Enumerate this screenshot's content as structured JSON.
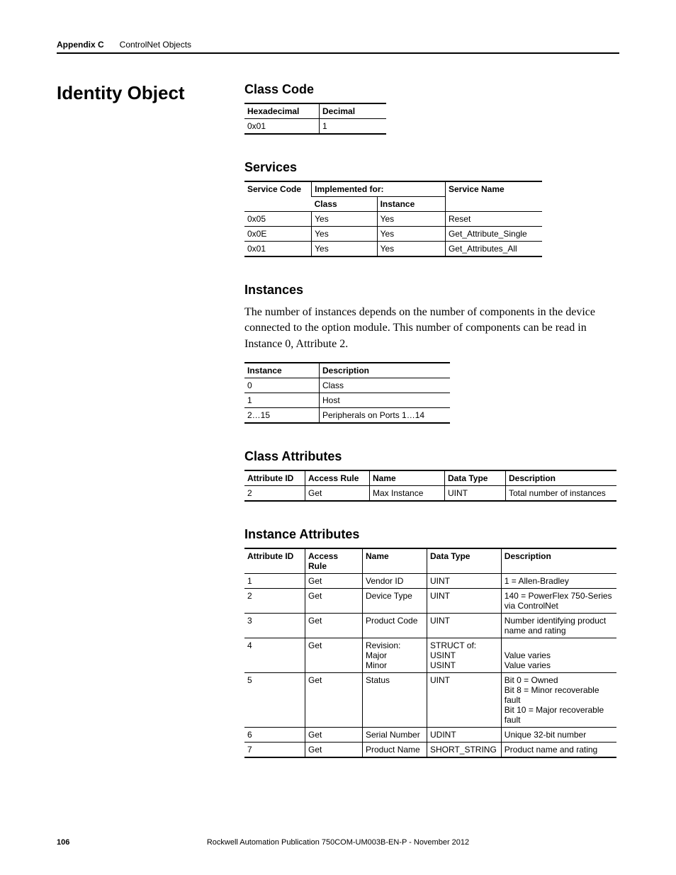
{
  "header": {
    "appendix": "Appendix C",
    "title": "ControlNet Objects"
  },
  "section_title": "Identity Object",
  "class_code": {
    "heading": "Class Code",
    "cols": [
      "Hexadecimal",
      "Decimal"
    ],
    "row": [
      "0x01",
      "1"
    ]
  },
  "services": {
    "heading": "Services",
    "implemented_for": "Implemented for:",
    "cols": [
      "Service Code",
      "Class",
      "Instance",
      "Service Name"
    ],
    "rows": [
      [
        "0x05",
        "Yes",
        "Yes",
        "Reset"
      ],
      [
        "0x0E",
        "Yes",
        "Yes",
        "Get_Attribute_Single"
      ],
      [
        "0x01",
        "Yes",
        "Yes",
        "Get_Attributes_All"
      ]
    ]
  },
  "instances": {
    "heading": "Instances",
    "text": "The number of instances depends on the number of components in the device connected to the option module. This number of components can be read in Instance 0, Attribute 2.",
    "cols": [
      "Instance",
      "Description"
    ],
    "rows": [
      [
        "0",
        "Class"
      ],
      [
        "1",
        "Host"
      ],
      [
        "2…15",
        "Peripherals on Ports 1…14"
      ]
    ]
  },
  "class_attributes": {
    "heading": "Class Attributes",
    "cols": [
      "Attribute ID",
      "Access Rule",
      "Name",
      "Data Type",
      "Description"
    ],
    "rows": [
      [
        "2",
        "Get",
        "Max Instance",
        "UINT",
        "Total number of instances"
      ]
    ]
  },
  "instance_attributes": {
    "heading": "Instance Attributes",
    "cols": [
      "Attribute ID",
      "Access Rule",
      "Name",
      "Data Type",
      "Description"
    ],
    "rows": [
      [
        "1",
        "Get",
        "Vendor ID",
        "UINT",
        "1 = Allen-Bradley"
      ],
      [
        "2",
        "Get",
        "Device Type",
        "UINT",
        "140 = PowerFlex 750-Series via ControlNet"
      ],
      [
        "3",
        "Get",
        "Product Code",
        "UINT",
        "Number identifying product name and rating"
      ],
      [
        "4",
        "Get",
        "Revision:\n   Major\n   Minor",
        "STRUCT of:\n   USINT\n   USINT",
        "\nValue varies\nValue varies"
      ],
      [
        "5",
        "Get",
        "Status",
        "UINT",
        "Bit 0 = Owned\nBit 8 = Minor recoverable fault\nBit 10 = Major recoverable fault"
      ],
      [
        "6",
        "Get",
        "Serial Number",
        "UDINT",
        "Unique 32-bit number"
      ],
      [
        "7",
        "Get",
        "Product Name",
        "SHORT_STRING",
        "Product name and rating"
      ]
    ]
  },
  "footer": {
    "page": "106",
    "publication": "Rockwell Automation Publication 750COM-UM003B-EN-P - November 2012"
  }
}
